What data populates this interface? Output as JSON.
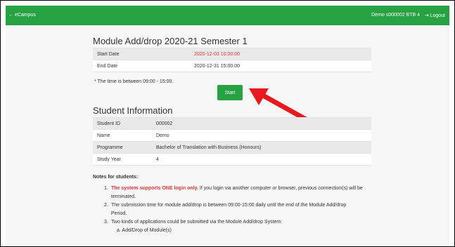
{
  "topbar": {
    "back_label": "← eCampus",
    "user_label": "Demo s000002 BTB 4",
    "logout_label": "⇥ Logout"
  },
  "page": {
    "title": "Module Add/drop 2020-21 Semester 1",
    "dates": [
      {
        "label": "Start Date",
        "value": "2020-12-03 10:00:00"
      },
      {
        "label": "End Date",
        "value": "2020-12-31 15:00:00"
      }
    ],
    "time_note": "* The time is between 09:00 - 15:00.",
    "start_button": "Start"
  },
  "student": {
    "heading": "Student Information",
    "rows": [
      {
        "label": "Student ID",
        "value": "000002"
      },
      {
        "label": "Name",
        "value": "Demo"
      },
      {
        "label": "Programme",
        "value": "Bachelor of Translation with Business (Honours)"
      },
      {
        "label": "Study Year",
        "value": "4"
      }
    ]
  },
  "notes": {
    "title": "Notes for students:",
    "item1_num": "1.",
    "item1_red": "The system supports ONE login only.",
    "item1_rest": " If you login via another computer or browser, previous connection(s) will be",
    "item1_cont": "terminated.",
    "item2_num": "2.",
    "item2_a": "The submission time for module add/drop is between 09:00-15:00 daily until the end of the Module Add/drop",
    "item2_b": "Period.",
    "item3_num": "3.",
    "item3": "Two kinds of applications could be submitted via the Module Add/drop System:",
    "item3a": "a. Add/Drop of Module(s)"
  },
  "colors": {
    "accent": "#27a243",
    "highlight": "#d9383a",
    "arrow": "#e8191c"
  }
}
